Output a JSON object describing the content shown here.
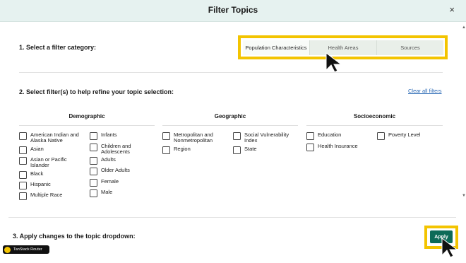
{
  "modal": {
    "title": "Filter Topics",
    "close_glyph": "×"
  },
  "step1": {
    "label": "1. Select a filter category:",
    "tabs": [
      {
        "label": "Population Characteristics",
        "active": true
      },
      {
        "label": "Health Areas",
        "active": false
      },
      {
        "label": "Sources",
        "active": false
      }
    ]
  },
  "step2": {
    "label": "2. Select filter(s) to help refine your topic selection:",
    "clear_all": "Clear all filters",
    "groups": {
      "demographic": {
        "title": "Demographic",
        "col1": [
          "American Indian and Alaska Native",
          "Asian",
          "Asian or Pacific Islander",
          "Black",
          "Hispanic",
          "Multiple Race"
        ],
        "col2": [
          "Infants",
          "Children and Adolescents",
          "Adults",
          "Older Adults",
          "Female",
          "Male"
        ]
      },
      "geographic": {
        "title": "Geographic",
        "col1": [
          "Metropolitan and Nonmetropolitan",
          "Region"
        ],
        "col2": [
          "Social Vulnerability Index",
          "State"
        ]
      },
      "socioeconomic": {
        "title": "Socioeconomic",
        "col1": [
          "Education",
          "Health Insurance"
        ],
        "col2": [
          "Poverty Level"
        ]
      }
    }
  },
  "step3": {
    "label": "3. Apply changes to the topic dropdown:",
    "apply": "Apply"
  },
  "devtools": {
    "label": "TanStack Router"
  },
  "colors": {
    "header_bg": "#e6f2f0",
    "highlight": "#f3c400",
    "apply_bg": "#0d6b58",
    "link": "#2d6bb6"
  }
}
